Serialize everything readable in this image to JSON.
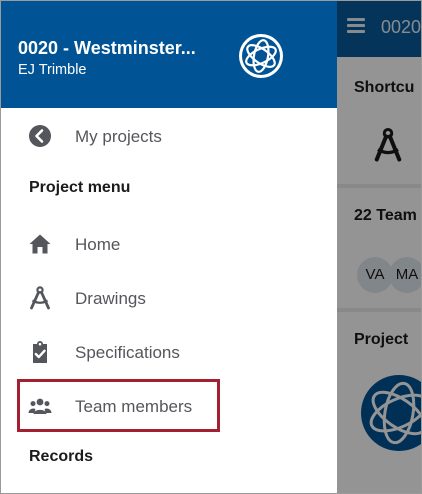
{
  "drawer": {
    "project_title": "0020 - Westminster...",
    "user_name": "EJ Trimble",
    "back_item": {
      "label": "My projects",
      "icon": "chevron-left-circle-icon"
    },
    "project_menu_header": "Project menu",
    "items": [
      {
        "label": "Home",
        "icon": "home-icon"
      },
      {
        "label": "Drawings",
        "icon": "drafting-compass-icon"
      },
      {
        "label": "Specifications",
        "icon": "clipboard-check-icon"
      },
      {
        "label": "Team members",
        "icon": "people-icon",
        "highlighted": true
      }
    ],
    "records_header": "Records"
  },
  "background_app": {
    "title_fragment": "0020",
    "shortcuts_fragment": "Shortcu",
    "team_fragment": "22 Team",
    "avatars": [
      "VA",
      "MA"
    ],
    "project_fragment": "Project"
  },
  "colors": {
    "header_blue": "#005395",
    "highlight_red": "#a2202f",
    "icon_gray": "#55565b",
    "text_gray": "#55565b"
  }
}
